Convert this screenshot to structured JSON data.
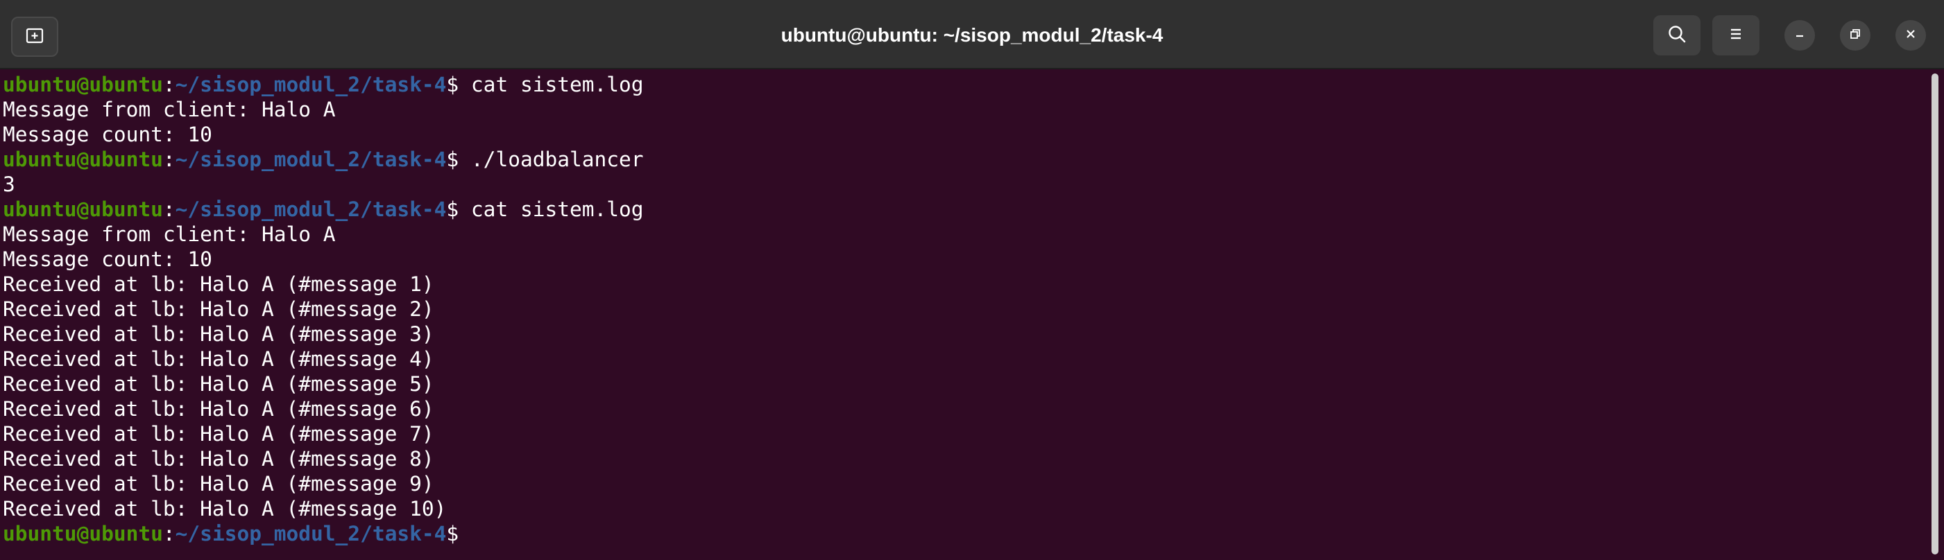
{
  "window": {
    "title": "ubuntu@ubuntu: ~/sisop_modul_2/task-4",
    "background_color": "#300a24",
    "titlebar_color": "#303030"
  },
  "titlebar": {
    "new_tab_icon": "new-tab-icon",
    "search_icon": "search-icon",
    "menu_icon": "hamburger-menu-icon",
    "minimize_icon": "minimize-icon",
    "maximize_icon": "maximize-icon",
    "close_icon": "close-icon"
  },
  "prompt": {
    "user_host": "ubuntu@ubuntu",
    "colon": ":",
    "path": "~/sisop_modul_2/task-4",
    "dollar": "$ ",
    "user_color": "#4e9a06",
    "path_color": "#3465a4"
  },
  "lines": [
    {
      "type": "prompt",
      "cmd": "cat sistem.log"
    },
    {
      "type": "output",
      "text": "Message from client: Halo A"
    },
    {
      "type": "output",
      "text": "Message count: 10"
    },
    {
      "type": "prompt",
      "cmd": "./loadbalancer"
    },
    {
      "type": "output",
      "text": "3"
    },
    {
      "type": "prompt",
      "cmd": "cat sistem.log"
    },
    {
      "type": "output",
      "text": "Message from client: Halo A"
    },
    {
      "type": "output",
      "text": "Message count: 10"
    },
    {
      "type": "output",
      "text": "Received at lb: Halo A (#message 1)"
    },
    {
      "type": "output",
      "text": "Received at lb: Halo A (#message 2)"
    },
    {
      "type": "output",
      "text": "Received at lb: Halo A (#message 3)"
    },
    {
      "type": "output",
      "text": "Received at lb: Halo A (#message 4)"
    },
    {
      "type": "output",
      "text": "Received at lb: Halo A (#message 5)"
    },
    {
      "type": "output",
      "text": "Received at lb: Halo A (#message 6)"
    },
    {
      "type": "output",
      "text": "Received at lb: Halo A (#message 7)"
    },
    {
      "type": "output",
      "text": "Received at lb: Halo A (#message 8)"
    },
    {
      "type": "output",
      "text": "Received at lb: Halo A (#message 9)"
    },
    {
      "type": "output",
      "text": "Received at lb: Halo A (#message 10)"
    },
    {
      "type": "prompt",
      "cmd": ""
    }
  ]
}
